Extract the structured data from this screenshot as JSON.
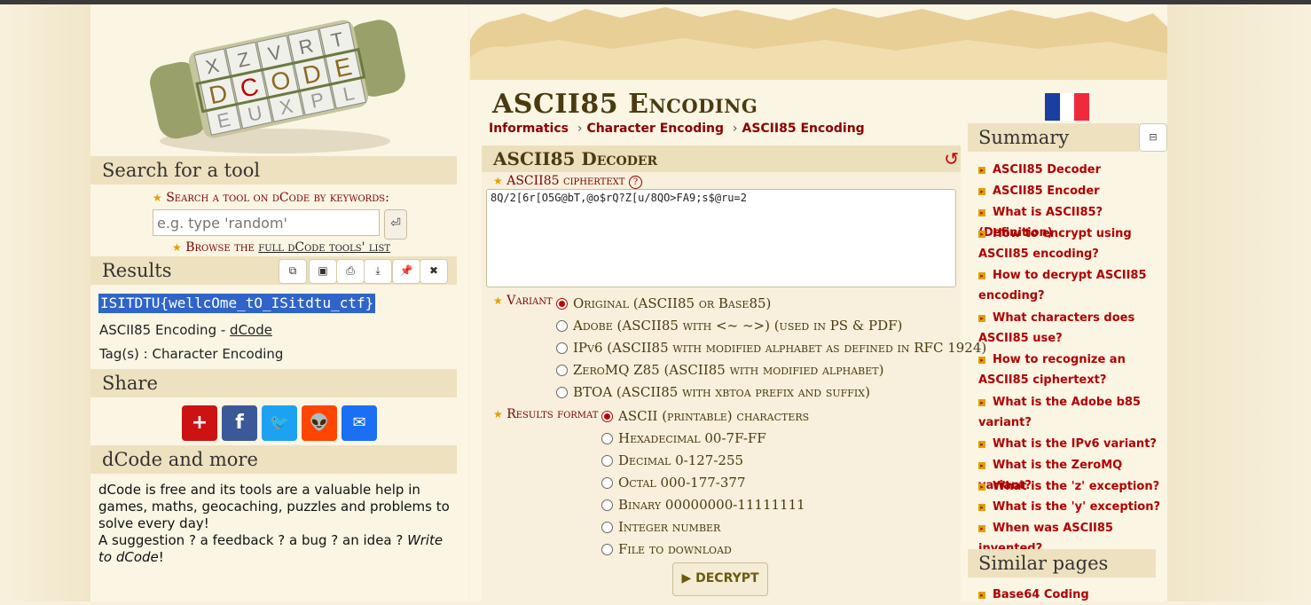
{
  "left": {
    "logo_letters": [
      "X",
      "Z",
      "V",
      "R",
      "T",
      "D",
      "C",
      "O",
      "D",
      "E",
      "E",
      "U",
      "X",
      "P",
      "L"
    ],
    "search_head": "Search for a tool",
    "search_label": "Search a tool on dCode by keywords:",
    "search_placeholder": "e.g. type 'random'",
    "enter_icon": "⏎",
    "browse_prefix": "Browse the ",
    "browse_link": "full dCode tools' list",
    "results_head": "Results",
    "result_value": "ISITDTU{wellcOme_tO_ISitdtu_ctf}",
    "result_source": "ASCII85 Encoding",
    "result_source_sep": " - ",
    "result_source_link": "dCode",
    "result_tags": "Tag(s) : Character Encoding",
    "share_head": "Share",
    "more_head": "dCode and more",
    "about_p1": "dCode is free and its tools are a valuable help in games, maths, geocaching, puzzles and problems to solve every day!",
    "about_p2_a": "A suggestion ? a feedback ? a bug ? an idea ? ",
    "about_p2_b": "Write to dCode",
    "about_p2_c": "!"
  },
  "main": {
    "title": "ASCII85 Encoding",
    "breadcrumbs": [
      "Informatics",
      "Character Encoding",
      "ASCII85 Encoding"
    ],
    "crumb_sep": "›",
    "panel_title": "ASCII85 Decoder",
    "refresh_icon": "↺",
    "cipher_label": "ASCII85 ciphertext",
    "help_icon": "?",
    "cipher_value": "8Q/2[6r[O5G@bT,@o$rQ?Z[u/8QO>FA9;s$@ru=2",
    "variant_label": "Variant",
    "variants": [
      "Original (ASCII85 or Base85)",
      "Adobe (ASCII85 with <~ ~>) (used in PS & PDF)",
      "IPv6 (ASCII85 with modified alphabet as defined in RFC 1924)",
      "ZeroMQ Z85 (ASCII85 with modified alphabet)",
      "BTOA (ASCII85 with xbtoa prefix and suffix)"
    ],
    "format_label": "Results format",
    "formats": [
      "ASCII (printable) characters",
      "Hexadecimal 00-7F-FF",
      "Decimal 0-127-255",
      "Octal 000-177-377",
      "Binary 00000000-11111111",
      "Integer number",
      "File to download"
    ],
    "decrypt_label": "DECRYPT",
    "decrypt_icon": "▶"
  },
  "summary": {
    "head": "Summary",
    "collapse_icon": "⊟",
    "items": [
      "ASCII85 Decoder",
      "ASCII85 Encoder",
      "What is ASCII85? (Definition)",
      "How to encrypt using ASCII85 encoding?",
      "How to decrypt ASCII85 encoding?",
      "What characters does ASCII85 use?",
      "How to recognize an ASCII85 ciphertext?",
      "What is the Adobe b85 variant?",
      "What is the IPv6 variant?",
      "What is the ZeroMQ variant?",
      "What is the 'z' exception?",
      "What is the 'y' exception?",
      "When was ASCII85 invented?"
    ],
    "similar_head": "Similar pages",
    "similar_items": [
      "Base64 Coding"
    ]
  },
  "colors": {
    "accent_red": "#b00000",
    "section_bg": "#eee1bf",
    "selection": "#2f64c9",
    "flag_blue": "#1a3fa0",
    "flag_red": "#ef2b3b"
  }
}
